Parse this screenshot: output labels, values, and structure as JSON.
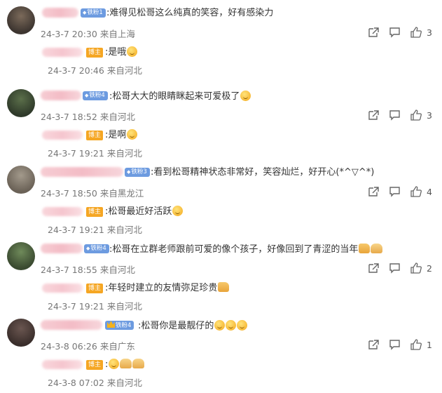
{
  "comments": [
    {
      "level": "铁粉1",
      "text": ":难得见松哥这么纯真的笑容，好有感染力",
      "time": "24-3-7 20:30",
      "location": "来自上海",
      "likes": "3",
      "reply": {
        "badge": "博主",
        "text": ":是哦",
        "time": "24-3-7 20:46",
        "location": "来自河北"
      }
    },
    {
      "level": "铁粉4",
      "text": ":松哥大大的眼睛眯起来可爱极了",
      "time": "24-3-7 18:52",
      "location": "来自河北",
      "likes": "3",
      "reply": {
        "badge": "博主",
        "text": ":是啊",
        "time": "24-3-7 19:21",
        "location": "来自河北"
      }
    },
    {
      "level": "铁粉3",
      "text": ":看到松哥精神状态非常好，笑容灿烂，好开心(*^▽^*)",
      "time": "24-3-7 18:50",
      "location": "来自黑龙江",
      "likes": "4",
      "reply": {
        "badge": "博主",
        "text": ":松哥最近好活跃",
        "time": "24-3-7 19:21",
        "location": "来自河北"
      }
    },
    {
      "level": "铁粉4",
      "text": ":松哥在立群老师跟前可爱的像个孩子，好像回到了青涩的当年",
      "time": "24-3-7 18:55",
      "location": "来自河北",
      "likes": "2",
      "reply": {
        "badge": "博主",
        "text": ":年轻时建立的友情弥足珍贵",
        "time": "24-3-7 19:21",
        "location": "来自河北"
      }
    },
    {
      "level": "铁粉4",
      "text": ":松哥你是最靓仔的",
      "time": "24-3-8 06:26",
      "location": "来自广东",
      "likes": "1",
      "reply": {
        "badge": "博主",
        "text": ":",
        "time": "24-3-8 07:02",
        "location": "来自河北"
      }
    }
  ],
  "icons": {
    "share": "share-icon",
    "comment": "comment-icon",
    "like": "thumbs-up-icon"
  },
  "colors": {
    "level_badge": "#6d9be0",
    "blogger_badge": "#f5a623",
    "meta_text": "#777777"
  }
}
